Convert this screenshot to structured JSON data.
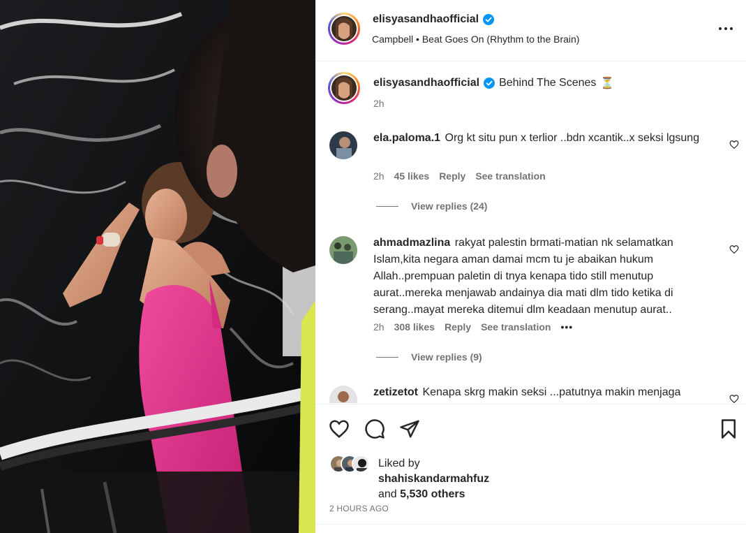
{
  "post": {
    "username": "elisyasandhaofficial",
    "verified": true,
    "audio": "Campbell • Beat Goes On (Rhythm to the Brain)"
  },
  "caption": {
    "username": "elisyasandhaofficial",
    "text": "Behind The Scenes",
    "emoji": "⏳",
    "time": "2h"
  },
  "comments": [
    {
      "username": "ela.paloma.1",
      "text": "Org kt situ pun x terlior ..bdn xcantik..x seksi lgsung",
      "time": "2h",
      "likes": "45 likes",
      "reply": "Reply",
      "translate": "See translation",
      "view_replies": "View replies (24)"
    },
    {
      "username": "ahmadmazlina",
      "text": "rakyat palestin brmati-matian nk selamatkan Islam,kita negara aman damai mcm tu je abaikan hukum Allah..prempuan paletin di tnya kenapa tido still menutup aurat..mereka menjawab andainya dia mati dlm tido ketika di serang..mayat mereka ditemui dlm keadaan menutup aurat..",
      "time": "2h",
      "likes": "308 likes",
      "reply": "Reply",
      "translate": "See translation",
      "more": "•••",
      "view_replies": "View replies (9)"
    },
    {
      "username": "zetizetot",
      "text": "Kenapa skrg makin seksi ...patutnya makin menjaga"
    }
  ],
  "likes": {
    "prefix": "Liked by",
    "user": "shahiskandarmahfuz",
    "and": "and",
    "others": "5,530 others"
  },
  "timestamp": "2 HOURS AGO",
  "icons": [
    "more-icon",
    "verified-badge-icon",
    "heart-icon",
    "comment-icon",
    "share-icon",
    "bookmark-icon"
  ],
  "colors": {
    "verified": "#0095f6",
    "text": "#262626",
    "secondary": "#737373",
    "dress": "#e6368f"
  }
}
